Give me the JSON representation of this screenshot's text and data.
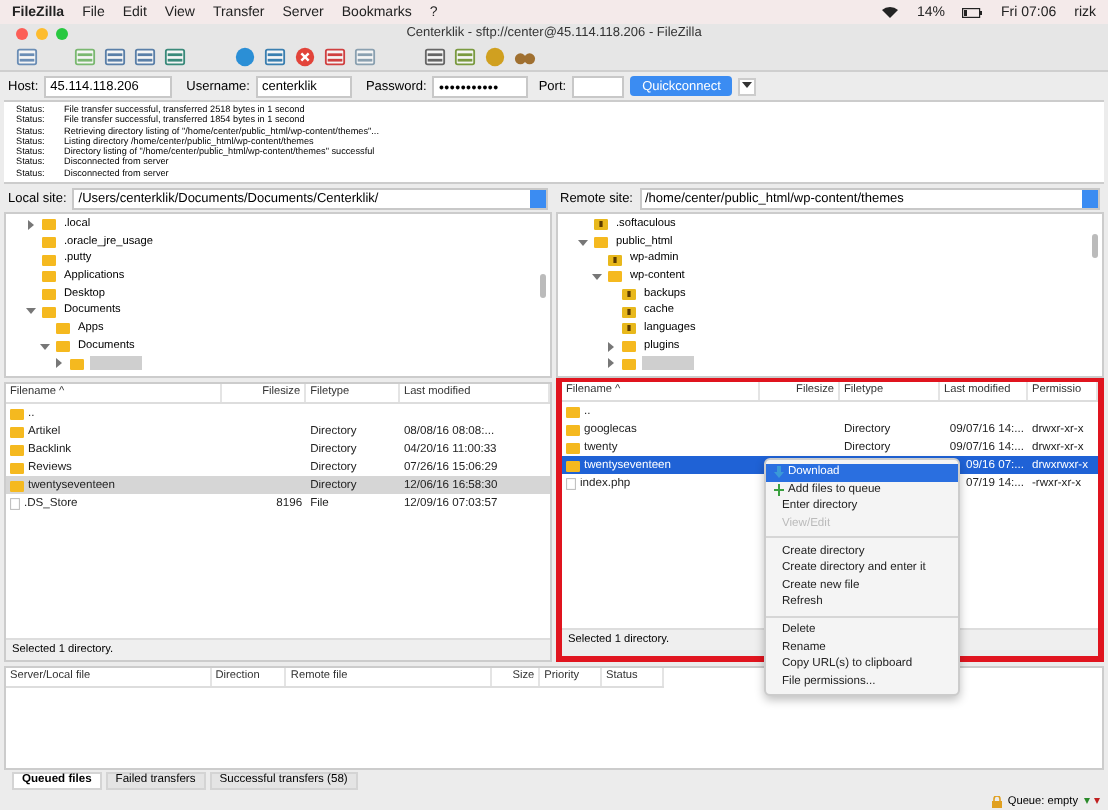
{
  "menubar": {
    "app_name": "FileZilla",
    "items": [
      "File",
      "Edit",
      "View",
      "Transfer",
      "Server",
      "Bookmarks",
      "?"
    ],
    "battery": "14%",
    "clock": "Fri 07:06",
    "user": "rizk"
  },
  "window": {
    "title": "Centerklik - sftp://center@45.114.118.206 - FileZilla"
  },
  "quickconnect": {
    "host_label": "Host:",
    "host": "45.114.118.206",
    "username_label": "Username:",
    "username": "centerklik",
    "password_label": "Password:",
    "password": "●●●●●●●●●●●",
    "port_label": "Port:",
    "button": "Quickconnect"
  },
  "log": [
    {
      "label": "Status:",
      "message": "File transfer successful, transferred 2518 bytes in 1 second"
    },
    {
      "label": "Status:",
      "message": "File transfer successful, transferred 1854 bytes in 1 second"
    },
    {
      "label": "Status:",
      "message": "Retrieving directory listing of \"/home/center/public_html/wp-content/themes\"..."
    },
    {
      "label": "Status:",
      "message": "Listing directory /home/center/public_html/wp-content/themes"
    },
    {
      "label": "Status:",
      "message": "Directory listing of \"/home/center/public_html/wp-content/themes\" successful"
    },
    {
      "label": "Status:",
      "message": "Disconnected from server"
    },
    {
      "label": "Status:",
      "message": "Disconnected from server"
    }
  ],
  "local": {
    "site_label": "Local site:",
    "path": "/Users/centerklik/Documents/Documents/Centerklik/",
    "tree": [
      {
        "label": ".local",
        "expanded": false,
        "has_children": true
      },
      {
        "label": ".oracle_jre_usage"
      },
      {
        "label": ".putty"
      },
      {
        "label": "Applications"
      },
      {
        "label": "Desktop"
      },
      {
        "label": "Documents",
        "expanded": true,
        "has_children": true,
        "children": [
          {
            "label": "Apps"
          },
          {
            "label": "Documents",
            "expanded": true,
            "has_children": true,
            "children": [
              {
                "selected": true,
                "has_children": true,
                "expanded": false
              }
            ]
          }
        ]
      }
    ],
    "columns": [
      "Filename ^",
      "Filesize",
      "Filetype",
      "Last modified"
    ],
    "rows": [
      {
        "name": "..",
        "kind": "folder",
        "selected": false
      },
      {
        "name": "Artikel",
        "type": "Directory",
        "modified": "08/08/16 08:08:...",
        "kind": "folder",
        "selected": false
      },
      {
        "name": "Backlink",
        "type": "Directory",
        "modified": "04/20/16 11:00:33",
        "kind": "folder",
        "selected": false
      },
      {
        "name": "Reviews",
        "type": "Directory",
        "modified": "07/26/16 15:06:29",
        "kind": "folder",
        "selected": false
      },
      {
        "name": "twentyseventeen",
        "type": "Directory",
        "modified": "12/06/16 16:58:30",
        "kind": "folder",
        "selected": true
      },
      {
        "name": ".DS_Store",
        "size": "8196",
        "type": "File",
        "modified": "12/09/16 07:03:57",
        "kind": "file",
        "selected": false
      }
    ],
    "status": "Selected 1 directory."
  },
  "remote": {
    "site_label": "Remote site:",
    "path": "/home/center/public_html/wp-content/themes",
    "tree": [
      {
        "label": ".softaculous",
        "unknown": true
      },
      {
        "label": "public_html",
        "expanded": true,
        "has_children": true,
        "children": [
          {
            "label": "wp-admin",
            "unknown": true
          },
          {
            "label": "wp-content",
            "expanded": true,
            "has_children": true,
            "children": [
              {
                "label": "backups",
                "unknown": true
              },
              {
                "label": "cache",
                "unknown": true
              },
              {
                "label": "languages",
                "unknown": true
              },
              {
                "label": "plugins",
                "has_children": true,
                "expanded": false
              },
              {
                "selected": true,
                "has_children": true,
                "expanded": false
              }
            ]
          }
        ]
      }
    ],
    "columns": [
      "Filename ^",
      "Filesize",
      "Filetype",
      "Last modified",
      "Permissio"
    ],
    "rows": [
      {
        "name": "..",
        "kind": "folder",
        "selected": false
      },
      {
        "name": "googlecas",
        "type": "Directory",
        "modified": "09/07/16 14:...",
        "perms": "drwxr-xr-x",
        "kind": "folder",
        "selected": false
      },
      {
        "name": "twenty",
        "type": "Directory",
        "modified": "09/07/16 14:...",
        "perms": "drwxr-xr-x",
        "kind": "folder",
        "selected": false
      },
      {
        "name": "twentyseventeen",
        "modified": "09/16 07:...",
        "perms": "drwxrwxr-x",
        "kind": "folder",
        "selected": true
      },
      {
        "name": "index.php",
        "modified": "07/19 14:...",
        "perms": "-rwxr-xr-x",
        "kind": "file",
        "selected": false
      }
    ],
    "status": "Selected 1 directory."
  },
  "context_menu": [
    {
      "kind": "download",
      "label": "Download",
      "highlighted": true
    },
    {
      "kind": "add",
      "label": "Add files to queue"
    },
    {
      "kind": "item",
      "label": "Enter directory"
    },
    {
      "kind": "item",
      "label": "View/Edit",
      "disabled": true
    },
    {
      "kind": "separator"
    },
    {
      "kind": "item",
      "label": "Create directory"
    },
    {
      "kind": "item",
      "label": "Create directory and enter it"
    },
    {
      "kind": "item",
      "label": "Create new file"
    },
    {
      "kind": "item",
      "label": "Refresh"
    },
    {
      "kind": "separator"
    },
    {
      "kind": "item",
      "label": "Delete"
    },
    {
      "kind": "item",
      "label": "Rename"
    },
    {
      "kind": "item",
      "label": "Copy URL(s) to clipboard"
    },
    {
      "kind": "item",
      "label": "File permissions..."
    }
  ],
  "queue": {
    "columns": [
      "Server/Local file",
      "Direction",
      "Remote file",
      "Size",
      "Priority",
      "Status"
    ]
  },
  "tabs": [
    {
      "label": "Queued files",
      "selected": true
    },
    {
      "label": "Failed transfers",
      "selected": false
    },
    {
      "label": "Successful transfers (58)",
      "selected": false
    }
  ],
  "status_bar": {
    "queue": "Queue: empty"
  }
}
